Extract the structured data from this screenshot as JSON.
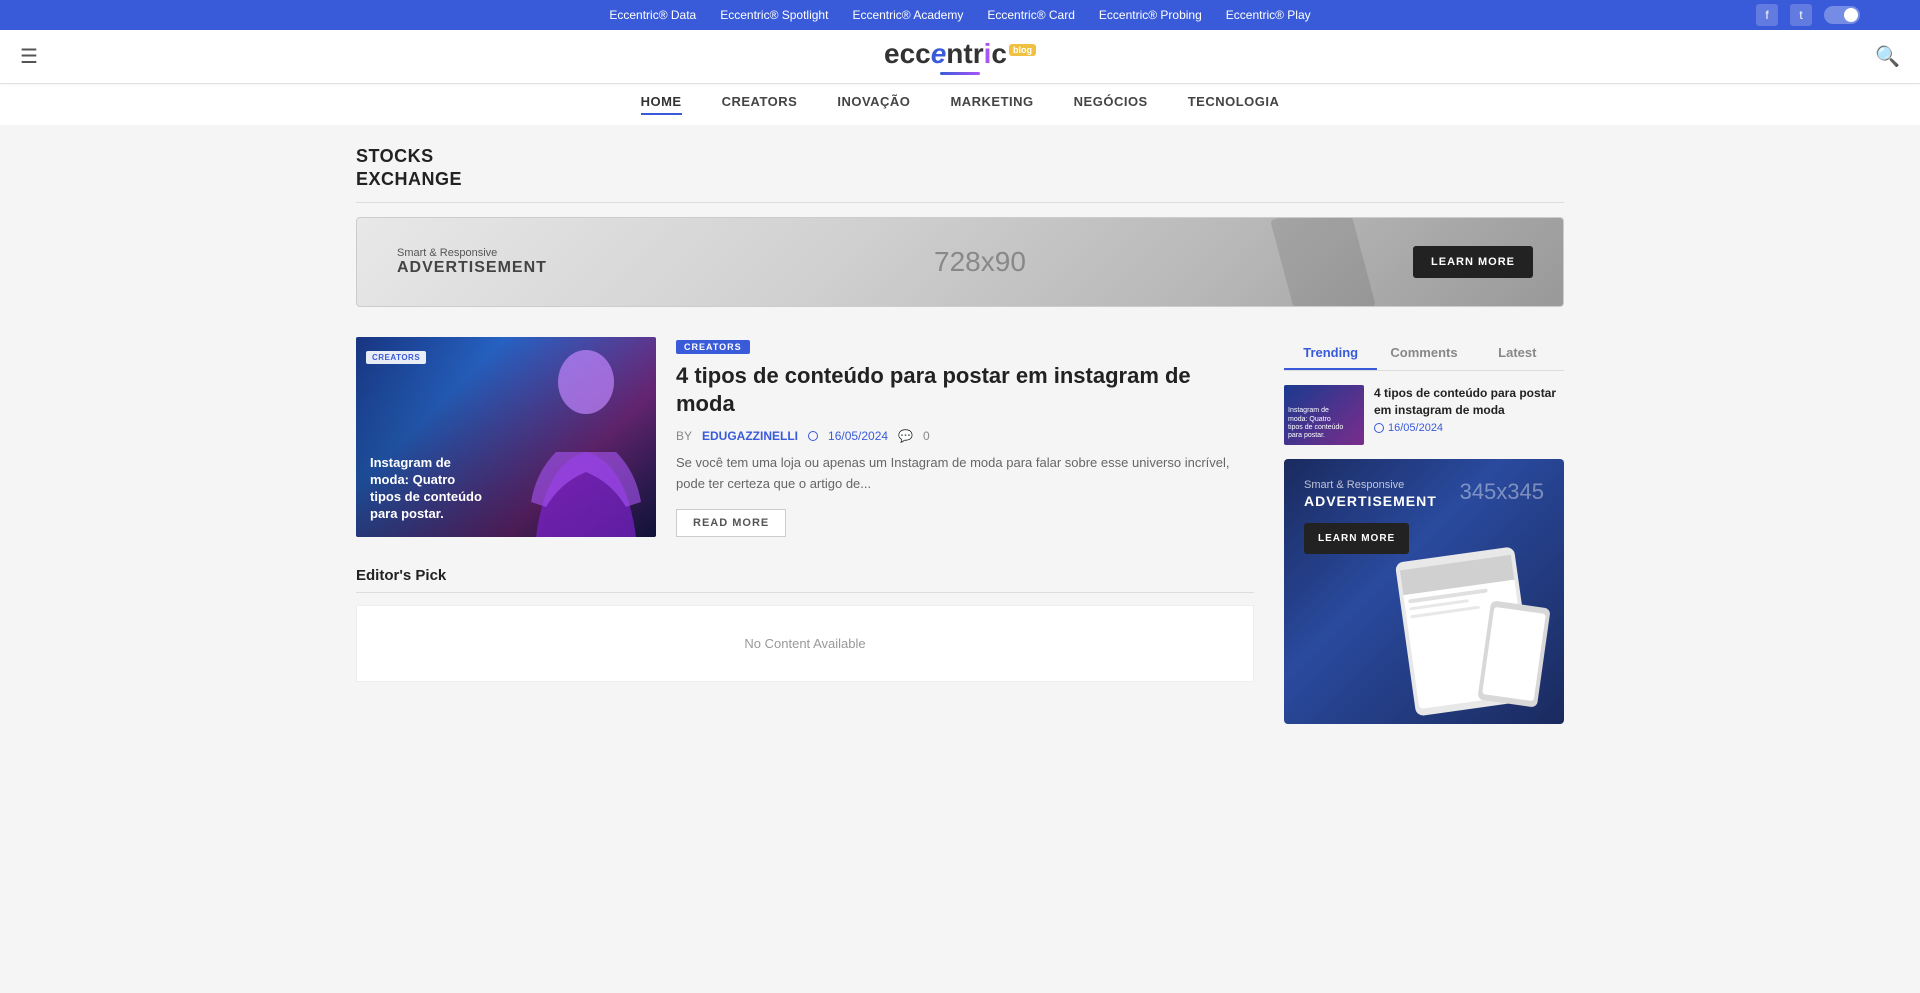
{
  "topbar": {
    "links": [
      {
        "label": "Eccentric® Data",
        "url": "#"
      },
      {
        "label": "Eccentric® Spotlight",
        "url": "#"
      },
      {
        "label": "Eccentric® Academy",
        "url": "#"
      },
      {
        "label": "Eccentric® Card",
        "url": "#"
      },
      {
        "label": "Eccentric® Probing",
        "url": "#"
      },
      {
        "label": "Eccentric® Play",
        "url": "#"
      }
    ]
  },
  "header": {
    "logo_part1": "ecc",
    "logo_part2": "entr",
    "logo_part3": "ic",
    "logo_badge": "blog",
    "hamburger_label": "☰",
    "search_label": "🔍"
  },
  "nav": {
    "items": [
      {
        "label": "HOME",
        "active": true
      },
      {
        "label": "CREATORS",
        "active": false
      },
      {
        "label": "INOVAÇÃO",
        "active": false
      },
      {
        "label": "MARKETING",
        "active": false
      },
      {
        "label": "NEGÓCIOS",
        "active": false
      },
      {
        "label": "TECNOLOGIA",
        "active": false
      }
    ]
  },
  "page": {
    "section_title_line1": "STOCKS",
    "section_title_line2": "EXCHANGE"
  },
  "ad_banner": {
    "smart_label": "Smart & Responsive",
    "title": "ADVERTISEMENT",
    "size": "728x90",
    "button_label": "LEARN MORE"
  },
  "featured_article": {
    "category": "CREATORS",
    "img_badge": "CREATORS",
    "img_text_line1": "Instagram de",
    "img_text_line2": "moda: Quatro",
    "img_text_line3": "tipos de conteúdo",
    "img_text_line4": "para postar.",
    "title": "4 tipos de conteúdo para postar em instagram de moda",
    "author": "EDUGAZZINELLI",
    "date": "16/05/2024",
    "comments": "0",
    "excerpt": "Se você tem uma loja ou apenas um Instagram de moda para falar sobre esse universo incrível, pode ter certeza que o artigo de...",
    "read_more_label": "READ MORE"
  },
  "editors_pick": {
    "title": "Editor's Pick",
    "no_content": "No Content Available"
  },
  "sidebar": {
    "tabs": [
      {
        "label": "Trending",
        "active": true
      },
      {
        "label": "Comments",
        "active": false
      },
      {
        "label": "Latest",
        "active": false
      }
    ],
    "trending_article": {
      "title": "4 tipos de conteúdo para postar em instagram de moda",
      "date": "16/05/2024",
      "img_text_line1": "Instagram de",
      "img_text_line2": "moda: Quatro",
      "img_text_line3": "tipos de conteúdo",
      "img_text_line4": "para postar."
    },
    "ad": {
      "smart_label": "Smart & Responsive",
      "title": "ADVERTISEMENT",
      "size": "345x345",
      "button_label": "LEARN MORE"
    }
  },
  "social": {
    "facebook_icon": "f",
    "twitter_icon": "t"
  }
}
